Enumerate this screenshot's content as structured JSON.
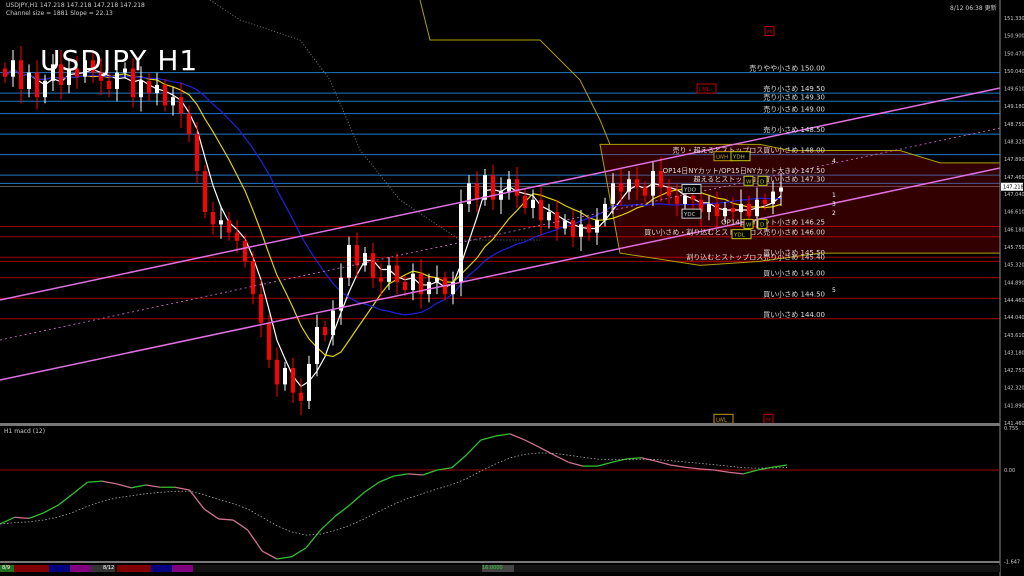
{
  "header": {
    "symbol_title": "USDJPY H1",
    "info_line": "USDJPY,H1  147.218 147.218 147.218 147.218",
    "channel_info": "Channel size = 1881 Slope = 22.13",
    "updated": "8/12 06:38 更新"
  },
  "colors": {
    "bull": "#ffffff",
    "bear": "#ff0000",
    "blue_level": "#1e78c8",
    "red_level": "#a00000",
    "channel": "#e070e0",
    "macd_up": "#30c030",
    "macd_down": "#d07090"
  },
  "chart_data": [
    {
      "type": "candlestick",
      "title": "USDJPY H1",
      "ylim": [
        141.46,
        151.33
      ],
      "y_ticks": [
        "151.330",
        "150.900",
        "150.470",
        "150.040",
        "149.610",
        "149.180",
        "148.750",
        "148.320",
        "147.890",
        "147.460",
        "147.040",
        "146.610",
        "146.180",
        "145.750",
        "145.320",
        "144.890",
        "144.460",
        "144.040",
        "143.610",
        "143.180",
        "142.750",
        "142.320",
        "141.890",
        "141.460"
      ],
      "current_price": "147.218",
      "closes": [
        149.9,
        150.3,
        149.6,
        150.0,
        149.4,
        149.8,
        150.2,
        149.7,
        150.1,
        149.9,
        150.3,
        150.0,
        149.8,
        149.6,
        150.0,
        150.1,
        149.4,
        149.8,
        149.5,
        149.7,
        149.2,
        149.4,
        149.0,
        148.5,
        147.6,
        146.6,
        146.3,
        146.4,
        146.1,
        145.9,
        145.4,
        144.6,
        143.9,
        143.0,
        142.4,
        142.8,
        142.2,
        142.0,
        142.9,
        143.8,
        143.6,
        144.2,
        145.0,
        145.8,
        145.3,
        145.6,
        145.0,
        144.9,
        145.3,
        144.9,
        144.7,
        145.1,
        144.6,
        144.9,
        145.0,
        144.6,
        144.9,
        146.8,
        147.3,
        146.9,
        147.5,
        146.9,
        147.1,
        147.4,
        147.0,
        146.7,
        146.9,
        146.4,
        146.6,
        146.2,
        146.4,
        146.0,
        146.3,
        146.1,
        146.4,
        146.8,
        147.3,
        147.1,
        147.4,
        147.2,
        147.0,
        147.6,
        147.2,
        147.0,
        146.8,
        147.0,
        146.9,
        146.6,
        146.8,
        146.5,
        146.7,
        146.6,
        146.8,
        146.5,
        146.9,
        146.8,
        147.1,
        147.2
      ],
      "levels": [
        {
          "price": 150.0,
          "label": "売りやや小さめ 150.00",
          "kind": "sell"
        },
        {
          "price": 149.5,
          "label": "売り小さめ 149.50",
          "kind": "sell"
        },
        {
          "price": 149.3,
          "label": "売り小さめ 149.30",
          "kind": "sell"
        },
        {
          "price": 149.0,
          "label": "売り小さめ 149.00",
          "kind": "sell"
        },
        {
          "price": 148.5,
          "label": "売り小さめ 148.50",
          "kind": "sell"
        },
        {
          "price": 148.0,
          "label": "売り・超えるとストップロス買い小さめ 148.00",
          "kind": "sell"
        },
        {
          "price": 147.5,
          "label": "OP14日NYカット/OP15日NYカット大きめ 147.50",
          "kind": "sell"
        },
        {
          "price": 147.3,
          "label": "超えるとストップロス買い小さめ 147.30",
          "kind": "sell"
        },
        {
          "price": 146.25,
          "label": "OP14日NYカット小さめ 146.25",
          "kind": "buy"
        },
        {
          "price": 146.0,
          "label": "買い小さめ・割り込むとストップロス売り小さめ 146.00",
          "kind": "buy"
        },
        {
          "price": 145.5,
          "label": "買い小さめ 145.50",
          "kind": "buy"
        },
        {
          "price": 145.4,
          "label": "割り込むとストップロス売り小さめ 145.40",
          "kind": "buy"
        },
        {
          "price": 145.0,
          "label": "買い小さめ 145.00",
          "kind": "buy"
        },
        {
          "price": 144.5,
          "label": "買い小さめ 144.50",
          "kind": "buy"
        },
        {
          "price": 144.0,
          "label": "買い小さめ 144.00",
          "kind": "buy"
        }
      ],
      "markers": [
        {
          "label": "LWH",
          "price": 147.95,
          "color": "#c89600"
        },
        {
          "label": "YDH",
          "price": 147.95,
          "color": "#c8c800"
        },
        {
          "label": "YDO",
          "price": 147.15,
          "color": "#cccccc"
        },
        {
          "label": "YDC",
          "price": 146.55,
          "color": "#cccccc"
        },
        {
          "label": "W",
          "price": 147.35,
          "color": "#c8c800"
        },
        {
          "label": "D",
          "price": 147.35,
          "color": "#c8c800"
        },
        {
          "label": "W",
          "price": 146.3,
          "color": "#c8c800"
        },
        {
          "label": "D",
          "price": 146.3,
          "color": "#c8c800"
        },
        {
          "label": "YDL",
          "price": 146.05,
          "color": "#c8c800"
        },
        {
          "label": "LWL",
          "price": 141.55,
          "color": "#c89600"
        },
        {
          "label": "M",
          "price": 141.55,
          "color": "#c00000"
        },
        {
          "label": "LML",
          "price": 149.6,
          "color": "#c00000"
        },
        {
          "label": "M",
          "price": 151.0,
          "color": "#c00000"
        }
      ],
      "channel_numbers": [
        "4",
        "1",
        "3",
        "2",
        "5"
      ]
    },
    {
      "type": "line",
      "title": "H1 macd (12)",
      "ylim": [
        -1.647,
        0.755
      ],
      "y_ticks": [
        "0.755",
        "0.00",
        "-1.647"
      ],
      "main": [
        -0.97,
        -0.85,
        -0.87,
        -0.77,
        -0.63,
        -0.43,
        -0.22,
        -0.2,
        -0.25,
        -0.32,
        -0.27,
        -0.31,
        -0.31,
        -0.36,
        -0.7,
        -0.88,
        -0.9,
        -1.08,
        -1.46,
        -1.6,
        -1.56,
        -1.4,
        -1.08,
        -0.83,
        -0.63,
        -0.4,
        -0.22,
        -0.11,
        -0.07,
        -0.09,
        0.0,
        0.04,
        0.27,
        0.54,
        0.61,
        0.65,
        0.54,
        0.41,
        0.27,
        0.14,
        0.07,
        0.07,
        0.14,
        0.2,
        0.22,
        0.16,
        0.09,
        0.05,
        0.02,
        0.0,
        -0.04,
        -0.07,
        0.0,
        0.05,
        0.09
      ]
    }
  ],
  "bottom_bar": {
    "dates": [
      "8/9",
      "8/12"
    ],
    "button": "16.0000"
  }
}
